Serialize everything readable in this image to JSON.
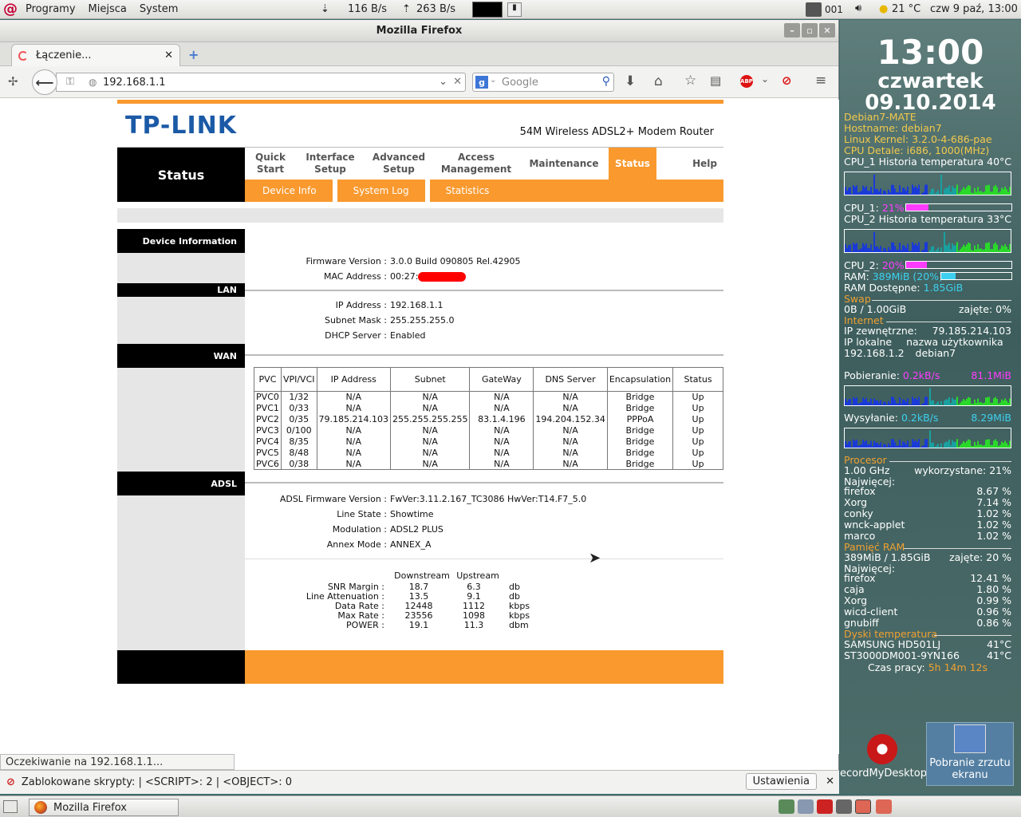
{
  "top_panel": {
    "menus": [
      "Programy",
      "Miejsca",
      "System"
    ],
    "net_down": "116 B/s",
    "net_up": "263 B/s",
    "counter": "001",
    "weather": "21 °C",
    "clock": "czw  9 paź, 13:00"
  },
  "window": {
    "title": "Mozilla Firefox",
    "tab_label": "Łączenie...",
    "url": "192.168.1.1",
    "search_placeholder": "Google",
    "status_text": "Oczekiwanie na 192.168.1.1...",
    "notification": "Zablokowane skrypty: | <SCRIPT>: 2 | <OBJECT>: 0",
    "notification_button": "Ustawienia"
  },
  "router": {
    "brand": "TP-LINK",
    "model": "54M Wireless ADSL2+ Modem Router",
    "menu_title": "Status",
    "menu": [
      {
        "l1": "Quick",
        "l2": "Start"
      },
      {
        "l1": "Interface",
        "l2": "Setup"
      },
      {
        "l1": "Advanced",
        "l2": "Setup"
      },
      {
        "l1": "Access",
        "l2": "Management"
      },
      {
        "l1": "Maintenance",
        "l2": ""
      },
      {
        "l1": "Status",
        "l2": ""
      },
      {
        "l1": "Help",
        "l2": ""
      }
    ],
    "submenu": [
      "Device Info",
      "System Log",
      "Statistics"
    ],
    "device_section": "Device Information",
    "firmware_label": "Firmware Version :",
    "firmware_value": "3.0.0 Build 090805 Rel.42905",
    "mac_label": "MAC Address :",
    "mac_value": "00:27:",
    "lan_section": "LAN",
    "ip_label": "IP Address :",
    "ip_value": "192.168.1.1",
    "mask_label": "Subnet Mask :",
    "mask_value": "255.255.255.0",
    "dhcp_label": "DHCP Server :",
    "dhcp_value": "Enabled",
    "wan_section": "WAN",
    "wan_headers": [
      "PVC",
      "VPI/VCI",
      "IP Address",
      "Subnet",
      "GateWay",
      "DNS Server",
      "Encapsulation",
      "Status"
    ],
    "wan_rows": [
      [
        "PVC0",
        "1/32",
        "N/A",
        "N/A",
        "N/A",
        "N/A",
        "Bridge",
        "Up"
      ],
      [
        "PVC1",
        "0/33",
        "N/A",
        "N/A",
        "N/A",
        "N/A",
        "Bridge",
        "Up"
      ],
      [
        "PVC2",
        "0/35",
        "79.185.214.103",
        "255.255.255.255",
        "83.1.4.196",
        "194.204.152.34",
        "PPPoA",
        "Up"
      ],
      [
        "PVC3",
        "0/100",
        "N/A",
        "N/A",
        "N/A",
        "N/A",
        "Bridge",
        "Up"
      ],
      [
        "PVC4",
        "8/35",
        "N/A",
        "N/A",
        "N/A",
        "N/A",
        "Bridge",
        "Up"
      ],
      [
        "PVC5",
        "8/48",
        "N/A",
        "N/A",
        "N/A",
        "N/A",
        "Bridge",
        "Up"
      ],
      [
        "PVC6",
        "0/38",
        "N/A",
        "N/A",
        "N/A",
        "N/A",
        "Bridge",
        "Up"
      ]
    ],
    "adsl_section": "ADSL",
    "adsl_fw_label": "ADSL Firmware Version :",
    "adsl_fw_value": "FwVer:3.11.2.167_TC3086 HwVer:T14.F7_5.0",
    "line_state_label": "Line State :",
    "line_state_value": "Showtime",
    "modulation_label": "Modulation :",
    "modulation_value": "ADSL2 PLUS",
    "annex_label": "Annex Mode :",
    "annex_value": "ANNEX_A",
    "stats_headers": [
      "Downstream",
      "Upstream"
    ],
    "stats_rows": [
      [
        "SNR Margin :",
        "18.7",
        "6.3",
        "db"
      ],
      [
        "Line Attenuation :",
        "13.5",
        "9.1",
        "db"
      ],
      [
        "Data Rate :",
        "12448",
        "1112",
        "kbps"
      ],
      [
        "Max Rate :",
        "23556",
        "1098",
        "kbps"
      ],
      [
        "POWER :",
        "19.1",
        "11.3",
        "dbm"
      ]
    ]
  },
  "conky": {
    "time": "13:00",
    "day": "czwartek",
    "date": "09.10.2014",
    "os": "Debian7-MATE",
    "hostname": "Hostname: debian7",
    "kernel": "Linux Kernel: 3.2.0-4-686-pae",
    "cpu_detail": "CPU Detale:  i686, 1000(MHz)",
    "cpu1_hist": "CPU_1 Historia",
    "cpu1_temp": "temperatura 40°C",
    "cpu1_label": "CPU_1:",
    "cpu1_pct": "21%",
    "cpu1_level": 21,
    "cpu2_hist": "CPU_2 Historia",
    "cpu2_temp": "temperatura 33°C",
    "cpu2_label": "CPU_2:",
    "cpu2_pct": "20%",
    "cpu2_level": 20,
    "ram_label": "RAM:",
    "ram_val": "389MiB (20%)",
    "ram_level": 20,
    "ram_avail_label": "RAM Dostępne:",
    "ram_avail": "1.85GiB",
    "swap_title": "Swap",
    "swap_val": "0B   / 1.00GiB",
    "swap_used": "zajęte: 0%",
    "internet_title": "Internet",
    "ext_ip_label": "IP zewnętrzne:",
    "ext_ip": "79.185.214.103",
    "local_ip_label": "IP lokalne",
    "user_label": "nazwa użytkownika",
    "local_ip": "192.168.1.2",
    "user": "debian7",
    "down_label": "Pobieranie:",
    "down_rate": "0.2kB/s",
    "down_total": "81.1MiB",
    "up_label": "Wysyłanie:",
    "up_rate": "0.2kB/s",
    "up_total": "8.29MiB",
    "proc_title": "Procesor",
    "proc_freq": "1.00 GHz",
    "proc_used": "wykorzystane: 21%",
    "most_label": "Najwięcej:",
    "procs": [
      [
        "firefox",
        "8.67 %"
      ],
      [
        "Xorg",
        "7.14 %"
      ],
      [
        "conky",
        "1.02 %"
      ],
      [
        "wnck-applet",
        "1.02 %"
      ],
      [
        "marco",
        "1.02 %"
      ]
    ],
    "mem_title": "Pamięć RAM",
    "mem_val": "389MiB / 1.85GiB",
    "mem_used": "zajęte: 20 %",
    "mems": [
      [
        "firefox",
        "12.41 %"
      ],
      [
        "caja",
        "1.80 %"
      ],
      [
        "Xorg",
        "0.99 %"
      ],
      [
        "wicd-client",
        "0.96 %"
      ],
      [
        "gnubiff",
        "0.86 %"
      ]
    ],
    "disk_title": "Dyski temperatura",
    "disks": [
      [
        "SAMSUNG HD501LJ",
        "41°C"
      ],
      [
        "ST3000DM001-9YN166",
        "41°C"
      ]
    ],
    "uptime_label": "Czas pracy:",
    "uptime": "5h 14m 12s"
  },
  "desktop": {
    "icon1": "ecordMyDesktop",
    "icon2_l1": "Pobranie zrzutu",
    "icon2_l2": "ekranu"
  },
  "taskbar": {
    "window_button": "Mozilla Firefox"
  }
}
